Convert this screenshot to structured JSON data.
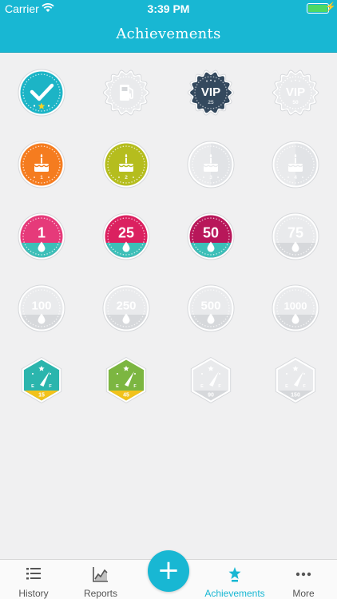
{
  "status": {
    "carrier": "Carrier",
    "time": "3:39 PM"
  },
  "header": {
    "title": "Achievements"
  },
  "badges": [
    [
      {
        "kind": "check",
        "color": "#1cb4c6",
        "earned": true
      },
      {
        "kind": "fuel-scallop",
        "color": "#e9eaec",
        "earned": false
      },
      {
        "kind": "vip",
        "color": "#34495e",
        "earned": true,
        "label": "VIP",
        "sub": "25"
      },
      {
        "kind": "vip",
        "color": "#e9eaec",
        "earned": false,
        "label": "VIP",
        "sub": "50"
      }
    ],
    [
      {
        "kind": "cake",
        "color": "#f57c1f",
        "earned": true,
        "sub": "1"
      },
      {
        "kind": "cake",
        "color": "#b5bd1e",
        "earned": true,
        "sub": "2"
      },
      {
        "kind": "cake",
        "color": "#e9eaec",
        "earned": false,
        "sub": "3"
      },
      {
        "kind": "cake",
        "color": "#e9eaec",
        "earned": false,
        "sub": "4"
      }
    ],
    [
      {
        "kind": "drop",
        "color": "#e63a7a",
        "band": "#3dbfb8",
        "earned": true,
        "label": "1"
      },
      {
        "kind": "drop",
        "color": "#db2160",
        "band": "#3dbfb8",
        "earned": true,
        "label": "25"
      },
      {
        "kind": "drop",
        "color": "#b8175a",
        "band": "#3dbfb8",
        "earned": true,
        "label": "50"
      },
      {
        "kind": "drop",
        "color": "#e9eaec",
        "band": "#d6d8db",
        "earned": false,
        "label": "75"
      }
    ],
    [
      {
        "kind": "drop",
        "color": "#e9eaec",
        "band": "#d6d8db",
        "earned": false,
        "label": "100"
      },
      {
        "kind": "drop",
        "color": "#e9eaec",
        "band": "#d6d8db",
        "earned": false,
        "label": "250"
      },
      {
        "kind": "drop",
        "color": "#e9eaec",
        "band": "#d6d8db",
        "earned": false,
        "label": "500"
      },
      {
        "kind": "drop",
        "color": "#e9eaec",
        "band": "#d6d8db",
        "earned": false,
        "label": "1000"
      }
    ],
    [
      {
        "kind": "gauge",
        "color": "#2bb5ad",
        "band": "#f2c21b",
        "earned": true,
        "sub": "15"
      },
      {
        "kind": "gauge",
        "color": "#7cb641",
        "band": "#f2c21b",
        "earned": true,
        "sub": "45"
      },
      {
        "kind": "gauge",
        "color": "#e9eaec",
        "band": "#d6d8db",
        "earned": false,
        "sub": "90"
      },
      {
        "kind": "gauge",
        "color": "#e9eaec",
        "band": "#d6d8db",
        "earned": false,
        "sub": "150"
      }
    ]
  ],
  "tabs": [
    {
      "label": "History",
      "icon": "list-icon",
      "active": false
    },
    {
      "label": "Reports",
      "icon": "chart-icon",
      "active": false
    },
    {
      "label": "Achievements",
      "icon": "trophy-icon",
      "active": true
    },
    {
      "label": "More",
      "icon": "more-icon",
      "active": false
    }
  ],
  "add_button": {
    "label": "+"
  }
}
